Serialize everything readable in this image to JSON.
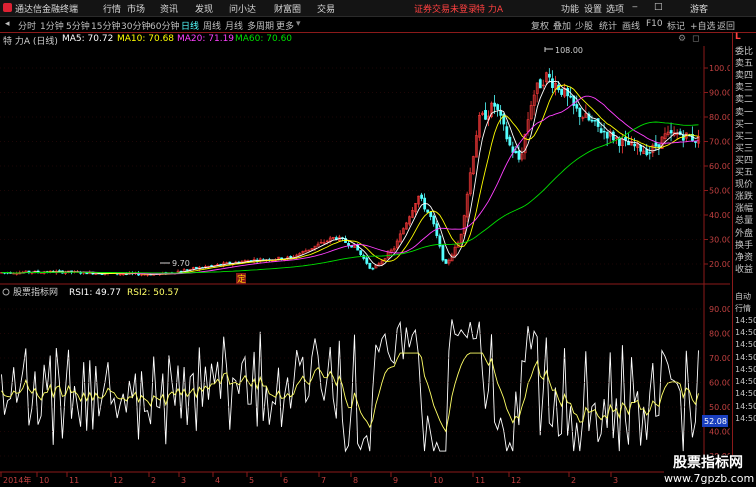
{
  "menu": {
    "app_title": "通达信金融终端",
    "items": [
      "行情",
      "市场",
      "资讯",
      "发现",
      "问小达",
      "财富圈",
      "交易"
    ],
    "notice": "证券交易未登录",
    "stock": "特 力A",
    "right_items": [
      "功能",
      "设置",
      "选项"
    ],
    "guest": "游客"
  },
  "periods": {
    "items": [
      "分时",
      "1分钟",
      "5分钟",
      "15分钟",
      "30分钟",
      "60分钟",
      "日线",
      "周线",
      "月线",
      "多周期",
      "更多"
    ],
    "active": "日线"
  },
  "toolbar_right": [
    "复权",
    "叠加",
    "少股",
    "统计",
    "画线",
    "F10",
    "标记",
    "+自选",
    "返回"
  ],
  "main_info": {
    "title": "特 力A (日线)",
    "ma5": "MA5: 70.72",
    "ma10": "MA10: 70.68",
    "ma20": "MA20: 71.19",
    "ma60": "MA60: 70.60"
  },
  "price_axis": [
    "100.0",
    "90.00",
    "80.00",
    "70.00",
    "60.00",
    "50.00",
    "40.00",
    "30.00",
    "20.00"
  ],
  "annotations": {
    "high": "108.00",
    "low": "9.70",
    "ding": "定"
  },
  "indicator_info": {
    "title": "股票指标网",
    "rsi1": "RSI1: 49.77",
    "rsi2": "RSI2: 50.57"
  },
  "indicator_axis": [
    "90.00",
    "80.00",
    "70.00",
    "60.00",
    "50.00",
    "40.00",
    "30.00"
  ],
  "indicator_current": "52.08",
  "time_axis": [
    "2014年",
    "10",
    "11",
    "12",
    "2",
    "3",
    "4",
    "5",
    "6",
    "7",
    "8",
    "9",
    "10",
    "11",
    "12",
    "2",
    "3"
  ],
  "right_panel": {
    "top_label": "L",
    "labels": [
      "委比",
      "卖五",
      "卖四",
      "卖三",
      "卖二",
      "卖一",
      "买一",
      "买二",
      "买三",
      "买四",
      "买五",
      "现价",
      "涨跌",
      "涨幅",
      "总量",
      "外盘",
      "换手",
      "净资",
      "收益"
    ],
    "bottom_labels": [
      "自动",
      "行情",
      "14:50",
      "14:50",
      "14:50",
      "14:50",
      "14:50",
      "14:50",
      "14:50",
      "14:50",
      "14:50"
    ]
  },
  "watermark": {
    "line1": "股票指标网",
    "line2": "www.7gpzb.com"
  },
  "colors": {
    "up": "#ff3b3b",
    "down": "#54ffff",
    "ma5": "#ffffff",
    "ma10": "#ffff00",
    "ma20": "#ff40ff",
    "ma60": "#00e000",
    "grid": "#8b1a1a",
    "rsi1": "#ffffff",
    "rsi2": "#ffff66"
  }
}
